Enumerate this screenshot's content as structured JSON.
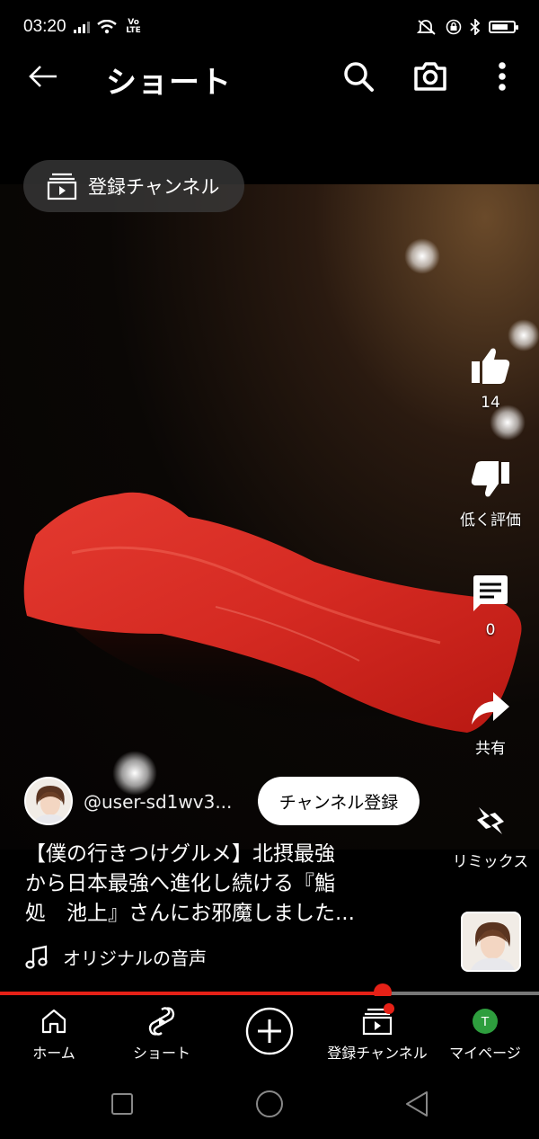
{
  "status_bar": {
    "time": "03:20",
    "network": "Vo LTE"
  },
  "app_bar": {
    "title": "ショート"
  },
  "subscriptions_pill": {
    "label": "登録チャンネル"
  },
  "actions": {
    "like_count": "14",
    "dislike_label": "低く評価",
    "comment_count": "0",
    "share_label": "共有",
    "remix_label": "リミックス"
  },
  "channel": {
    "handle": "@user-sd1wv3...",
    "subscribe_label": "チャンネル登録"
  },
  "caption": {
    "line1": "【僕の行きつけグルメ】北摂最強",
    "line2": "から日本最強へ進化し続ける『鮨",
    "line3": "処　池上』さんにお邪魔しました..."
  },
  "sound": {
    "label": "オリジナルの音声"
  },
  "progress": {
    "fraction": 0.71
  },
  "battery_level": 0.75,
  "bottom_nav": {
    "home": "ホーム",
    "shorts": "ショート",
    "subscriptions": "登録チャンネル",
    "mypage": "マイページ",
    "avatar_letter": "T"
  },
  "colors": {
    "accent_red": "#e62117",
    "avatar_green": "#2e9e3e"
  }
}
